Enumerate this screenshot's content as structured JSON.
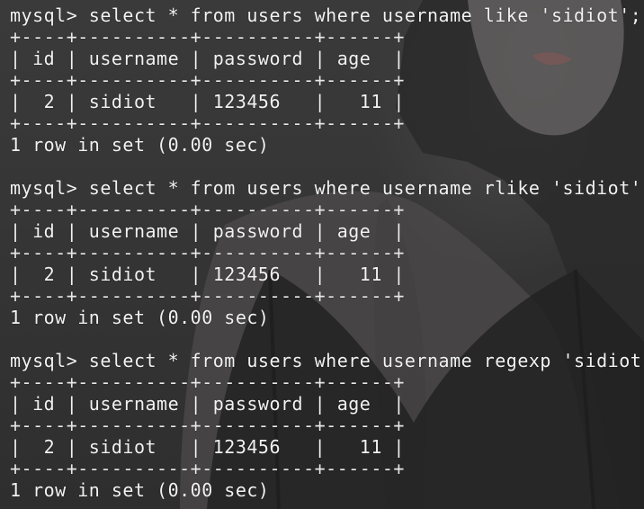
{
  "theme": {
    "text_color": "#f2f2f2",
    "background": "#333333"
  },
  "queries": [
    {
      "prompt": "mysql> select * from users where username like 'sidiot';",
      "border": "+----+----------+----------+------+",
      "header": "| id | username | password | age  |",
      "row": "|  2 | sidiot   | 123456   |   11 |",
      "summary": "1 row in set (0.00 sec)"
    },
    {
      "prompt": "mysql> select * from users where username rlike 'sidiot';",
      "border": "+----+----------+----------+------+",
      "header": "| id | username | password | age  |",
      "row": "|  2 | sidiot   | 123456   |   11 |",
      "summary": "1 row in set (0.00 sec)"
    },
    {
      "prompt": "mysql> select * from users where username regexp 'sidiot';",
      "border": "+----+----------+----------+------+",
      "header": "| id | username | password | age  |",
      "row": "|  2 | sidiot   | 123456   |   11 |",
      "summary": "1 row in set (0.00 sec)"
    }
  ]
}
